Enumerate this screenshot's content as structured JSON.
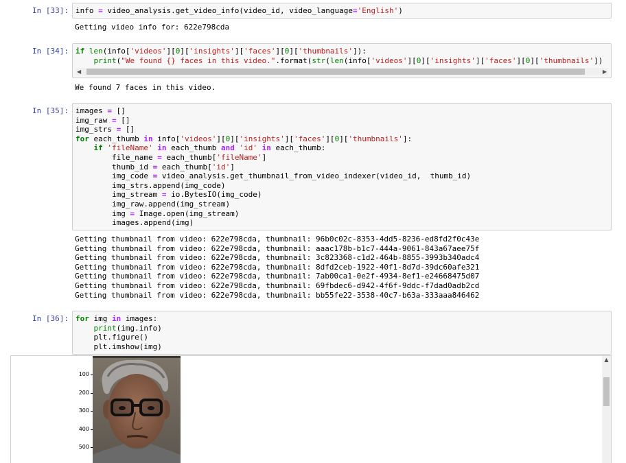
{
  "cells": [
    {
      "prompt": "In [33]:",
      "code_lines": [
        [
          {
            "t": "info "
          },
          {
            "t": "=",
            "c": "op"
          },
          {
            "t": " video_analysis.get_video_info(video_id, video_language"
          },
          {
            "t": "=",
            "c": "op"
          },
          {
            "t": "'English'",
            "c": "st"
          },
          {
            "t": ")"
          }
        ]
      ],
      "output": [
        "Getting video info for: 622e798cda"
      ]
    },
    {
      "prompt": "In [34]:",
      "code_lines": [
        [
          {
            "t": "if",
            "c": "kw"
          },
          {
            "t": " "
          },
          {
            "t": "len",
            "c": "bi"
          },
          {
            "t": "(info["
          },
          {
            "t": "'videos'",
            "c": "st"
          },
          {
            "t": "]["
          },
          {
            "t": "0",
            "c": "nu"
          },
          {
            "t": "]["
          },
          {
            "t": "'insights'",
            "c": "st"
          },
          {
            "t": "]["
          },
          {
            "t": "'faces'",
            "c": "st"
          },
          {
            "t": "]["
          },
          {
            "t": "0",
            "c": "nu"
          },
          {
            "t": "]["
          },
          {
            "t": "'thumbnails'",
            "c": "st"
          },
          {
            "t": "]):"
          }
        ],
        [
          {
            "t": "    "
          },
          {
            "t": "print",
            "c": "bi"
          },
          {
            "t": "("
          },
          {
            "t": "\"We found {} faces in this video.\"",
            "c": "st"
          },
          {
            "t": ".format("
          },
          {
            "t": "str",
            "c": "bi"
          },
          {
            "t": "("
          },
          {
            "t": "len",
            "c": "bi"
          },
          {
            "t": "(info["
          },
          {
            "t": "'videos'",
            "c": "st"
          },
          {
            "t": "]["
          },
          {
            "t": "0",
            "c": "nu"
          },
          {
            "t": "]["
          },
          {
            "t": "'insights'",
            "c": "st"
          },
          {
            "t": "]["
          },
          {
            "t": "'faces'",
            "c": "st"
          },
          {
            "t": "]["
          },
          {
            "t": "0",
            "c": "nu"
          },
          {
            "t": "]["
          },
          {
            "t": "'thumbnails'",
            "c": "st"
          },
          {
            "t": "])"
          }
        ]
      ],
      "output": [
        "We found 7 faces in this video."
      ]
    },
    {
      "prompt": "In [35]:",
      "code_lines": [
        [
          {
            "t": "images "
          },
          {
            "t": "=",
            "c": "op"
          },
          {
            "t": " []"
          }
        ],
        [
          {
            "t": "img_raw "
          },
          {
            "t": "=",
            "c": "op"
          },
          {
            "t": " []"
          }
        ],
        [
          {
            "t": "img_strs "
          },
          {
            "t": "=",
            "c": "op"
          },
          {
            "t": " []"
          }
        ],
        [
          {
            "t": "for",
            "c": "kw"
          },
          {
            "t": " each_thumb "
          },
          {
            "t": "in",
            "c": "op"
          },
          {
            "t": " info["
          },
          {
            "t": "'videos'",
            "c": "st"
          },
          {
            "t": "]["
          },
          {
            "t": "0",
            "c": "nu"
          },
          {
            "t": "]["
          },
          {
            "t": "'insights'",
            "c": "st"
          },
          {
            "t": "]["
          },
          {
            "t": "'faces'",
            "c": "st"
          },
          {
            "t": "]["
          },
          {
            "t": "0",
            "c": "nu"
          },
          {
            "t": "]["
          },
          {
            "t": "'thumbnails'",
            "c": "st"
          },
          {
            "t": "]:"
          }
        ],
        [
          {
            "t": "    "
          },
          {
            "t": "if",
            "c": "kw"
          },
          {
            "t": " "
          },
          {
            "t": "'fileName'",
            "c": "st"
          },
          {
            "t": " "
          },
          {
            "t": "in",
            "c": "op"
          },
          {
            "t": " each_thumb "
          },
          {
            "t": "and",
            "c": "op"
          },
          {
            "t": " "
          },
          {
            "t": "'id'",
            "c": "st"
          },
          {
            "t": " "
          },
          {
            "t": "in",
            "c": "op"
          },
          {
            "t": " each_thumb:"
          }
        ],
        [
          {
            "t": "        file_name "
          },
          {
            "t": "=",
            "c": "op"
          },
          {
            "t": " each_thumb["
          },
          {
            "t": "'fileName'",
            "c": "st"
          },
          {
            "t": "]"
          }
        ],
        [
          {
            "t": "        thumb_id "
          },
          {
            "t": "=",
            "c": "op"
          },
          {
            "t": " each_thumb["
          },
          {
            "t": "'id'",
            "c": "st"
          },
          {
            "t": "]"
          }
        ],
        [
          {
            "t": "        img_code "
          },
          {
            "t": "=",
            "c": "op"
          },
          {
            "t": " video_analysis.get_thumbnail_from_video_indexer(video_id,  thumb_id)"
          }
        ],
        [
          {
            "t": "        img_strs.append(img_code)"
          }
        ],
        [
          {
            "t": "        img_stream "
          },
          {
            "t": "=",
            "c": "op"
          },
          {
            "t": " io.BytesIO(img_code)"
          }
        ],
        [
          {
            "t": "        img_raw.append(img_stream)"
          }
        ],
        [
          {
            "t": "        img "
          },
          {
            "t": "=",
            "c": "op"
          },
          {
            "t": " Image.open(img_stream)"
          }
        ],
        [
          {
            "t": "        images.append(img)"
          }
        ]
      ],
      "output": [
        "Getting thumbnail from video: 622e798cda, thumbnail: 96b0c02c-8353-4dd5-8236-ed8fd2f0c43e",
        "Getting thumbnail from video: 622e798cda, thumbnail: aaac178b-b1c7-444a-9061-843a67aee75f",
        "Getting thumbnail from video: 622e798cda, thumbnail: 3c823368-c1d2-464b-8855-3993b340adc4",
        "Getting thumbnail from video: 622e798cda, thumbnail: 8dfd2ceb-1922-40f1-8d7d-39dc60afe321",
        "Getting thumbnail from video: 622e798cda, thumbnail: 7ab00ca1-0e2f-4934-8ef1-e24668475d07",
        "Getting thumbnail from video: 622e798cda, thumbnail: 69fbdec6-d942-4f6f-9ddc-f7dad0adb2cd",
        "Getting thumbnail from video: 622e798cda, thumbnail: bb55fe22-3538-40c7-b63a-333aaa846462"
      ]
    },
    {
      "prompt": "In [36]:",
      "code_lines": [
        [
          {
            "t": "for",
            "c": "kw"
          },
          {
            "t": " img "
          },
          {
            "t": "in",
            "c": "op"
          },
          {
            "t": " images:"
          }
        ],
        [
          {
            "t": "    "
          },
          {
            "t": "print",
            "c": "bi"
          },
          {
            "t": "(img.info)"
          }
        ],
        [
          {
            "t": "    plt.figure()"
          }
        ],
        [
          {
            "t": "    plt.imshow(img)"
          }
        ]
      ],
      "output": []
    }
  ],
  "plot": {
    "y_ticks": [
      "100",
      "200",
      "300",
      "400",
      "500"
    ],
    "image_subject": "face-thumbnail"
  },
  "colors": {
    "prompt": "#303F9F",
    "keyword": "#008000",
    "string": "#BA2121",
    "operator": "#AA22FF"
  }
}
